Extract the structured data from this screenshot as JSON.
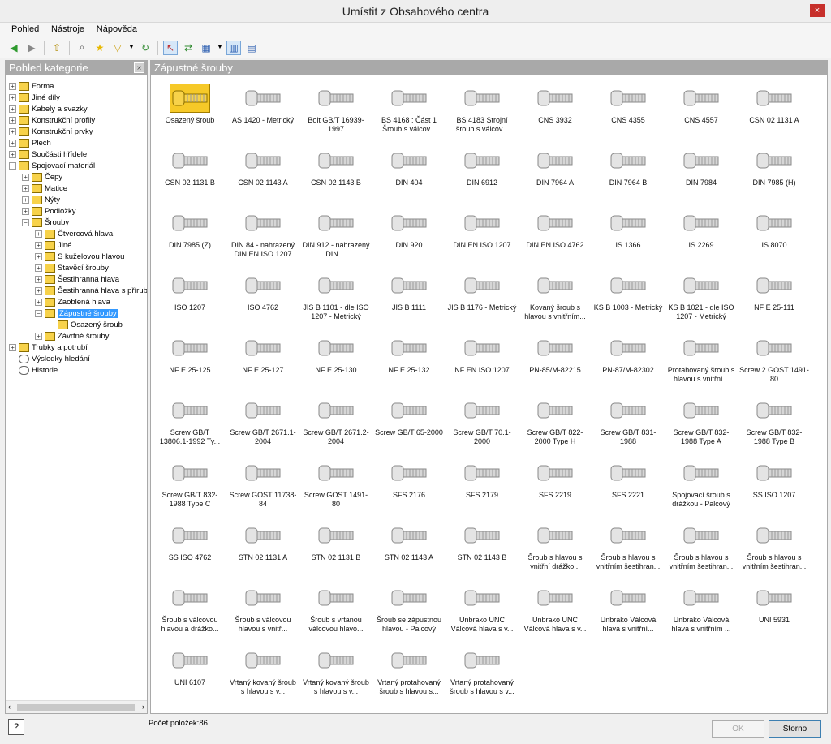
{
  "window": {
    "title": "Umístit z Obsahového centra",
    "close_glyph": "×"
  },
  "menu": [
    "Pohled",
    "Nástroje",
    "Nápověda"
  ],
  "toolbar": [
    {
      "name": "back-icon",
      "glyph": "◀",
      "color": "#2e9a2e"
    },
    {
      "name": "forward-icon",
      "glyph": "▶",
      "color": "#888888"
    },
    {
      "name": "up-folder-icon",
      "glyph": "⇧",
      "color": "#b08a00"
    },
    {
      "name": "search-icon",
      "glyph": "⌕",
      "color": "#555555"
    },
    {
      "name": "favorites-icon",
      "glyph": "★",
      "color": "#e8b800"
    },
    {
      "name": "filter-icon",
      "glyph": "▽",
      "color": "#c99a00",
      "dropdown": true
    },
    {
      "name": "refresh-icon",
      "glyph": "↻",
      "color": "#2e8a2e"
    },
    {
      "name": "pointer-icon",
      "glyph": "↖",
      "color": "#c03030",
      "active": true
    },
    {
      "name": "sync-icon",
      "glyph": "⇄",
      "color": "#2e8a2e"
    },
    {
      "name": "view-options-icon",
      "glyph": "▦",
      "color": "#2a5db0",
      "dropdown": true
    },
    {
      "name": "tree-view-icon",
      "glyph": "▥",
      "color": "#2a5db0",
      "active": true
    },
    {
      "name": "table-view-icon",
      "glyph": "▤",
      "color": "#2a5db0"
    }
  ],
  "left_panel": {
    "title": "Pohled kategorie",
    "close_glyph": "×"
  },
  "tree": [
    {
      "label": "Forma",
      "depth": 0,
      "exp": "+"
    },
    {
      "label": "Jiné díly",
      "depth": 0,
      "exp": "+"
    },
    {
      "label": "Kabely a svazky",
      "depth": 0,
      "exp": "+"
    },
    {
      "label": "Konstrukční profily",
      "depth": 0,
      "exp": "+"
    },
    {
      "label": "Konstrukční prvky",
      "depth": 0,
      "exp": "+"
    },
    {
      "label": "Plech",
      "depth": 0,
      "exp": "+"
    },
    {
      "label": "Součásti hřídele",
      "depth": 0,
      "exp": "+"
    },
    {
      "label": "Spojovací materiál",
      "depth": 0,
      "exp": "−"
    },
    {
      "label": "Čepy",
      "depth": 1,
      "exp": "+"
    },
    {
      "label": "Matice",
      "depth": 1,
      "exp": "+"
    },
    {
      "label": "Nýty",
      "depth": 1,
      "exp": "+"
    },
    {
      "label": "Podložky",
      "depth": 1,
      "exp": "+"
    },
    {
      "label": "Šrouby",
      "depth": 1,
      "exp": "−"
    },
    {
      "label": "Čtvercová hlava",
      "depth": 2,
      "exp": "+"
    },
    {
      "label": "Jiné",
      "depth": 2,
      "exp": "+"
    },
    {
      "label": "S kuželovou hlavou",
      "depth": 2,
      "exp": "+"
    },
    {
      "label": "Stavěcí šrouby",
      "depth": 2,
      "exp": "+"
    },
    {
      "label": "Šestihranná hlava",
      "depth": 2,
      "exp": "+"
    },
    {
      "label": "Šestihranná hlava s přírubou",
      "depth": 2,
      "exp": "+"
    },
    {
      "label": "Zaoblená hlava",
      "depth": 2,
      "exp": "+"
    },
    {
      "label": "Zápustné šrouby",
      "depth": 2,
      "exp": "−",
      "selected": true
    },
    {
      "label": "Osazený šroub",
      "depth": 3,
      "exp": ""
    },
    {
      "label": "Závrtné šrouby",
      "depth": 2,
      "exp": "+"
    },
    {
      "label": "Trubky a potrubí",
      "depth": 0,
      "exp": "+"
    },
    {
      "label": "Výsledky hledání",
      "depth": 0,
      "exp": "",
      "special": true
    },
    {
      "label": "Historie",
      "depth": 0,
      "exp": "",
      "special": true
    }
  ],
  "scroll": {
    "left": "‹",
    "right": "›"
  },
  "right_panel": {
    "title": "Zápustné šrouby"
  },
  "items": [
    "Osazený šroub",
    "AS 1420 - Metrický",
    "Bolt GB/T 16939-1997",
    "BS 4168 : Část 1 Šroub s válcov...",
    "BS 4183 Strojní šroub s válcov...",
    "CNS 3932",
    "CNS 4355",
    "CNS 4557",
    "CSN 02 1131 A",
    "CSN 02 1131 B",
    "CSN 02 1143 A",
    "CSN 02 1143 B",
    "DIN 404",
    "DIN 6912",
    "DIN 7964 A",
    "DIN 7964 B",
    "DIN 7984",
    "DIN 7985 (H)",
    "DIN 7985 (Z)",
    "DIN 84 - nahrazený DIN EN ISO 1207",
    "DIN 912 - nahrazený DIN ...",
    "DIN 920",
    "DIN EN ISO 1207",
    "DIN EN ISO 4762",
    "IS 1366",
    "IS 2269",
    "IS 8070",
    "ISO 1207",
    "ISO 4762",
    "JIS B 1101 - dle ISO 1207 - Metrický",
    "JIS B 1111",
    "JIS B 1176 - Metrický",
    "Kovaný šroub s hlavou s vnitřním...",
    "KS B 1003 - Metrický",
    "KS B 1021 - dle ISO 1207 - Metrický",
    "NF E 25-111",
    "NF E 25-125",
    "NF E 25-127",
    "NF E 25-130",
    "NF E 25-132",
    "NF EN ISO 1207",
    "PN-85/M-82215",
    "PN-87/M-82302",
    "Protahovaný šroub s hlavou s vnitřní...",
    "Screw 2 GOST 1491-80",
    "Screw GB/T 13806.1-1992 Ty...",
    "Screw GB/T 2671.1-2004",
    "Screw GB/T 2671.2-2004",
    "Screw GB/T 65-2000",
    "Screw GB/T 70.1-2000",
    "Screw GB/T 822-2000 Type H",
    "Screw GB/T 831-1988",
    "Screw GB/T 832-1988 Type A",
    "Screw GB/T 832-1988 Type B",
    "Screw GB/T 832-1988 Type C",
    "Screw GOST 11738-84",
    "Screw GOST 1491-80",
    "SFS 2176",
    "SFS 2179",
    "SFS 2219",
    "SFS 2221",
    "Spojovací šroub s drážkou - Palcový",
    "SS ISO 1207",
    "SS ISO 4762",
    "STN 02 1131 A",
    "STN 02 1131 B",
    "STN 02 1143 A",
    "STN 02 1143 B",
    "Šroub s hlavou s vnitřní drážko...",
    "Šroub s hlavou s vnitřním šestihran...",
    "Šroub s hlavou s vnitřním šestihran...",
    "Šroub s hlavou s vnitřním šestihran...",
    "Šroub s válcovou hlavou a drážko...",
    "Šroub s válcovou hlavou s vnitř...",
    "Šroub s vrtanou válcovou hlavo...",
    "Šroub se zápustnou hlavou - Palcový",
    "Unbrako UNC Válcová hlava s v...",
    "Unbrako UNC Válcová hlava s v...",
    "Unbrako Válcová hlava s vnitřní...",
    "Unbrako Válcová hlava s vnitřním ...",
    "UNI 5931",
    "UNI 6107",
    "Vrtaný kovaný šroub s hlavou s v...",
    "Vrtaný kovaný šroub s hlavou s v...",
    "Vrtaný protahovaný šroub s hlavou s...",
    "Vrtaný protahovaný šroub s hlavou s v..."
  ],
  "status": {
    "count_label": "Počet položek:86",
    "help_glyph": "?",
    "ok_label": "OK",
    "cancel_label": "Storno"
  }
}
